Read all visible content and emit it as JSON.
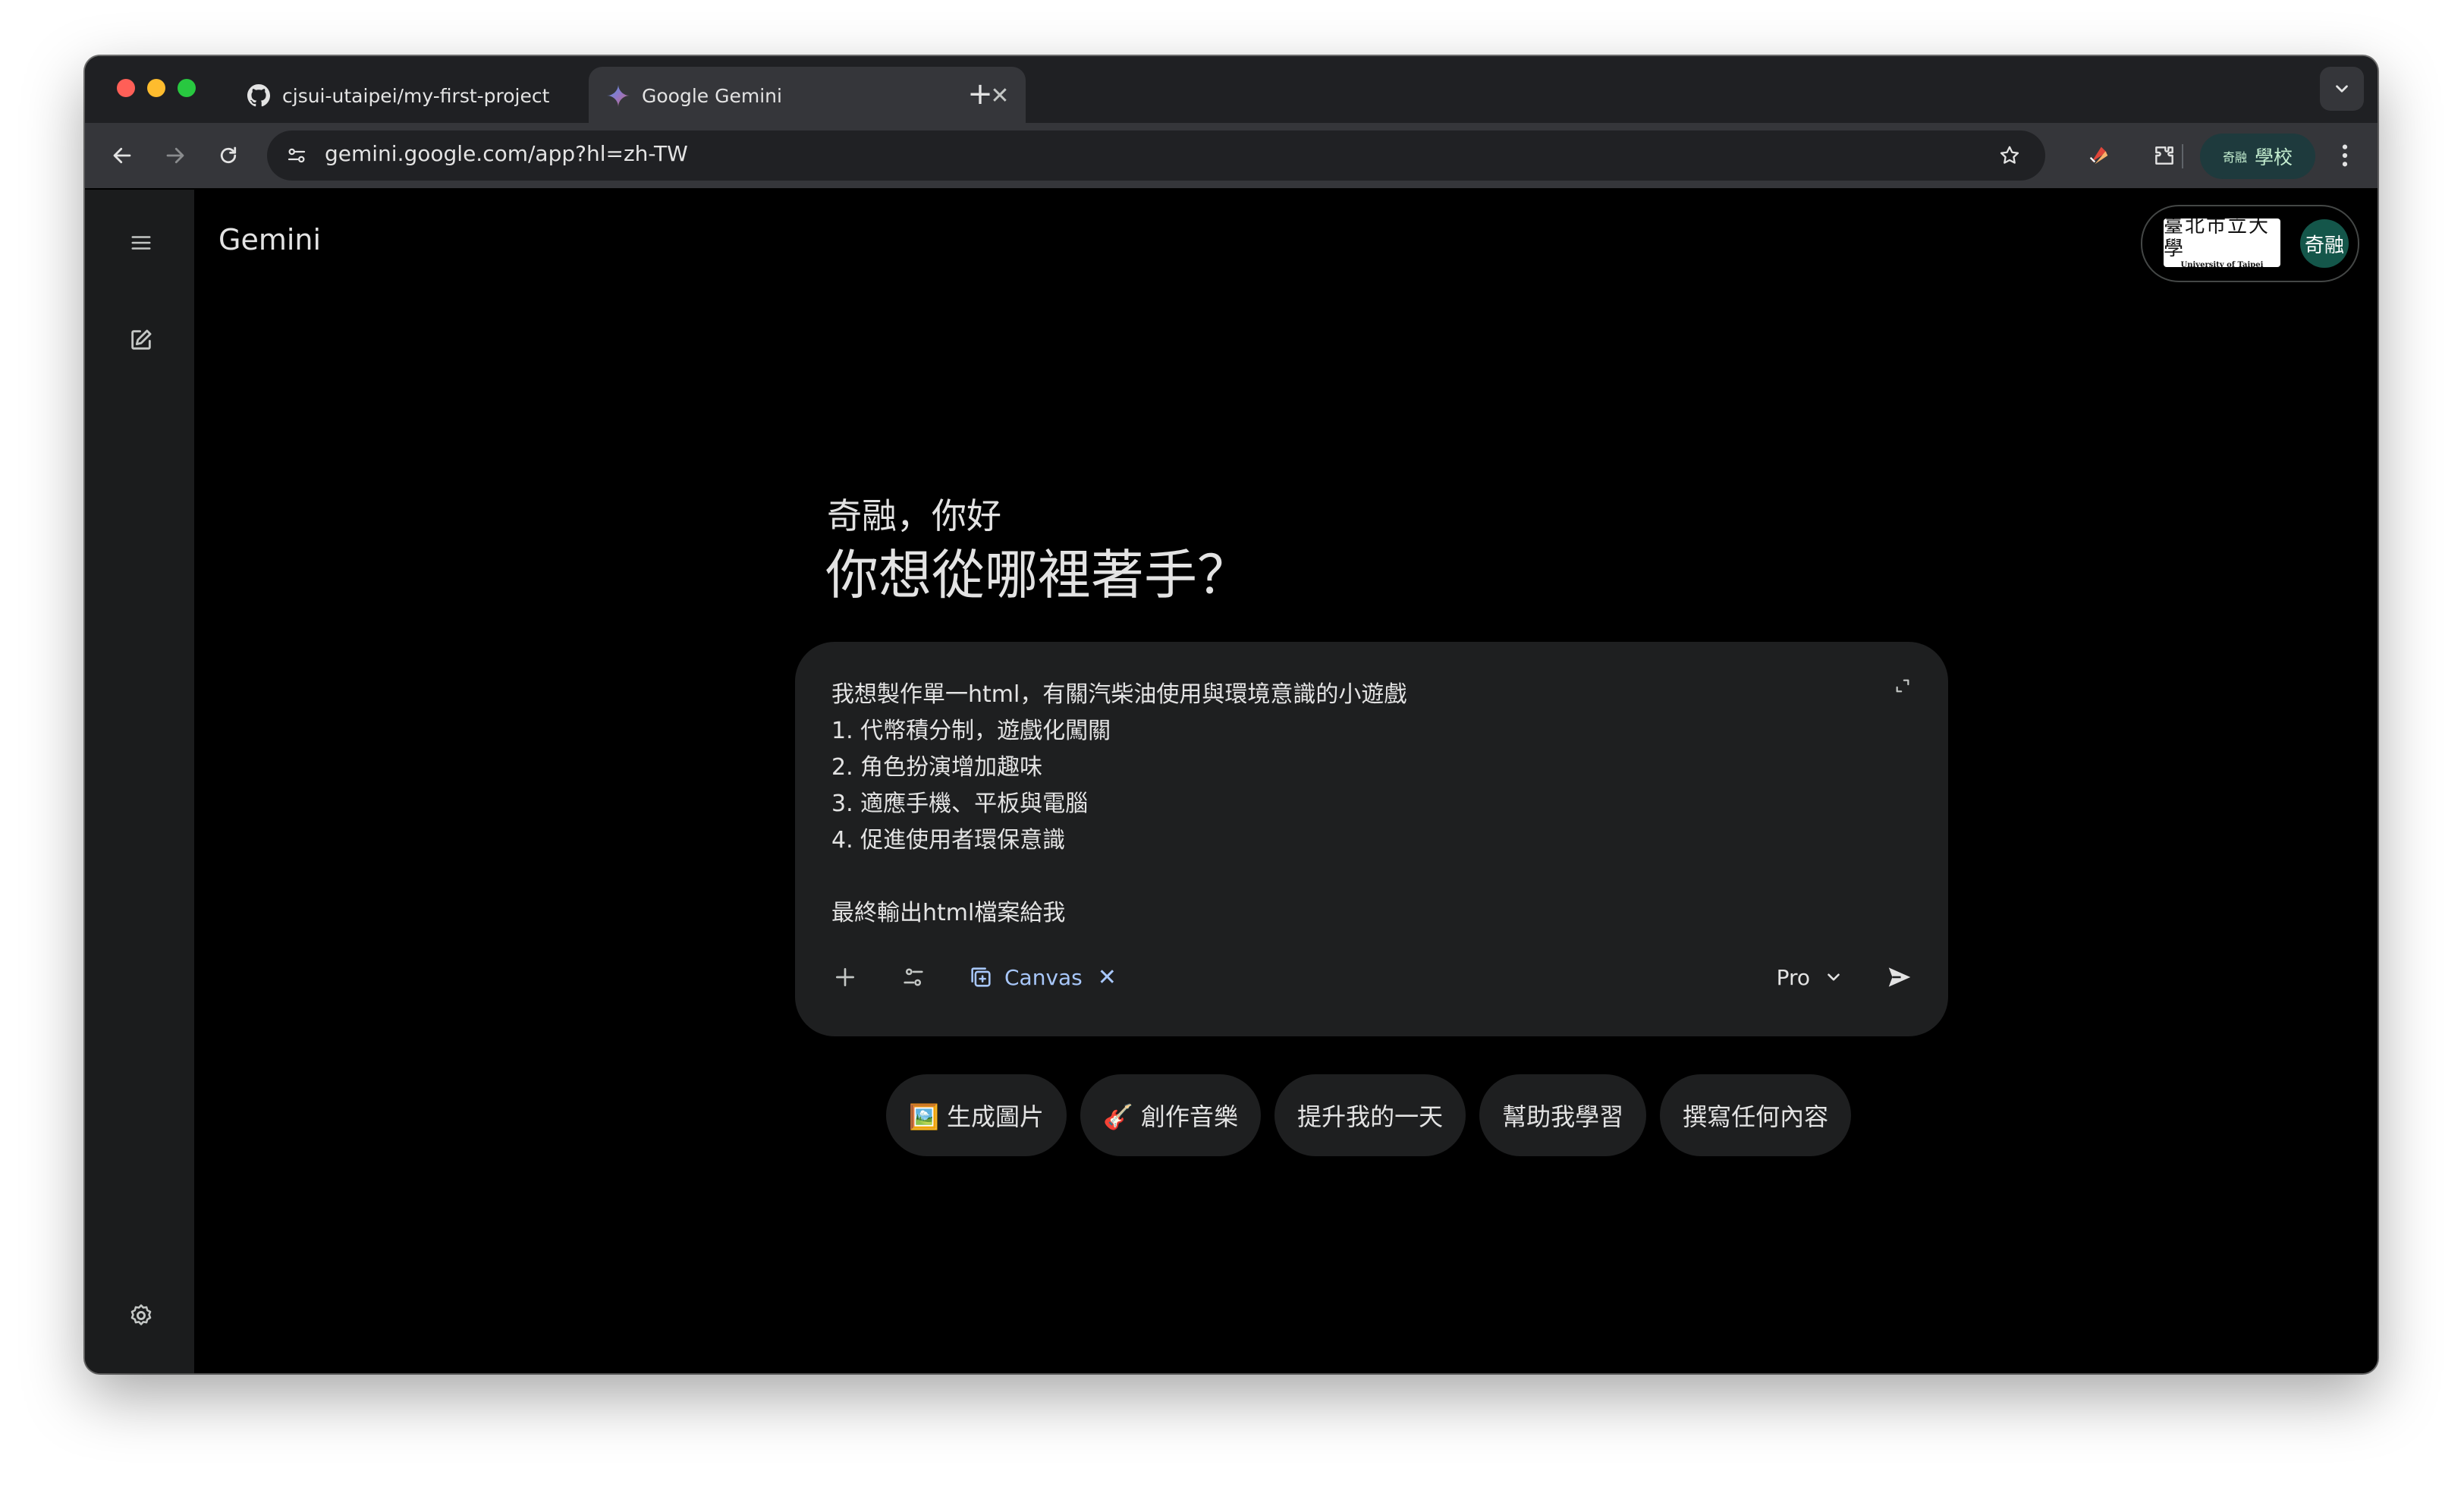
{
  "browser": {
    "tabs": [
      {
        "title": "cjsui-utaipei/my-first-project",
        "icon": "github-icon",
        "active": false
      },
      {
        "title": "Google Gemini",
        "icon": "gemini-sparkle-icon",
        "active": true
      }
    ],
    "url": "gemini.google.com/app?hl=zh-TW",
    "profile": {
      "small_label": "奇融",
      "label": "學校"
    }
  },
  "app": {
    "brand": "Gemini",
    "account": {
      "avatar_text": "奇融",
      "logo_text": "臺北市立大學",
      "logo_subtext": "University of Taipei"
    },
    "greeting": {
      "small": "奇融，你好",
      "big": "你想從哪裡著手？"
    },
    "composer": {
      "prompt": "我想製作單一html，有關汽柴油使用與環境意識的小遊戲\n1. 代幣積分制，遊戲化闖關\n2. 角色扮演增加趣味\n3. 適應手機、平板與電腦\n4. 促進使用者環保意識\n\n最終輸出html檔案給我",
      "tool_chip": "Canvas",
      "model": "Pro"
    },
    "suggestions": [
      "🖼️ 生成圖片",
      "🎸 創作音樂",
      "提升我的一天",
      "幫助我學習",
      "撰寫任何內容"
    ]
  },
  "colors": {
    "background": "#000000",
    "sidebar": "#1b1c1d",
    "composer": "#1e1f20",
    "accent_blue": "#a8c7fa",
    "avatar": "#14564a"
  }
}
